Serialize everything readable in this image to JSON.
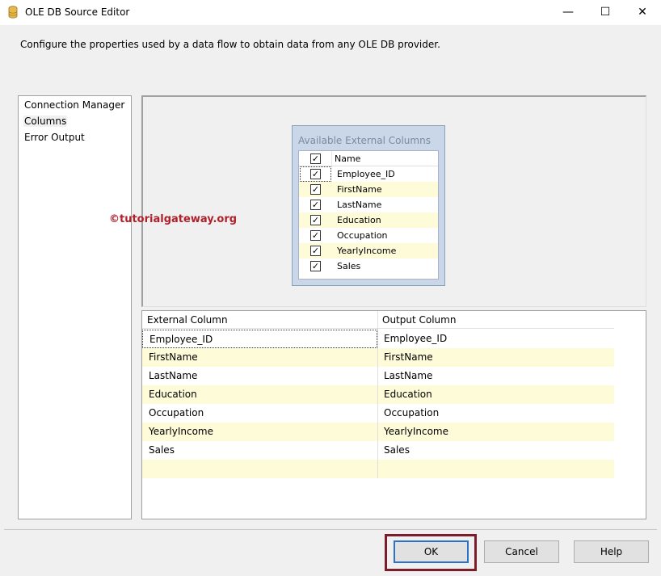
{
  "window": {
    "title": "OLE DB Source Editor",
    "minimize_glyph": "—",
    "maximize_glyph": "☐",
    "close_glyph": "✕",
    "icon": "database-icon"
  },
  "description": "Configure the properties used by a data flow to obtain data from any OLE DB provider.",
  "nav": {
    "items": [
      {
        "label": "Connection Manager",
        "selected": false
      },
      {
        "label": "Columns",
        "selected": true
      },
      {
        "label": "Error Output",
        "selected": false
      }
    ]
  },
  "available_columns": {
    "title": "Available External Columns",
    "header": "Name",
    "check_glyph": "✓",
    "columns": [
      {
        "name": "Employee_ID",
        "checked": true
      },
      {
        "name": "FirstName",
        "checked": true
      },
      {
        "name": "LastName",
        "checked": true
      },
      {
        "name": "Education",
        "checked": true
      },
      {
        "name": "Occupation",
        "checked": true
      },
      {
        "name": "YearlyIncome",
        "checked": true
      },
      {
        "name": "Sales",
        "checked": true
      }
    ]
  },
  "watermark": "©tutorialgateway.org",
  "mapping_grid": {
    "headers": [
      "External Column",
      "Output Column"
    ],
    "rows": [
      [
        "Employee_ID",
        "Employee_ID"
      ],
      [
        "FirstName",
        "FirstName"
      ],
      [
        "LastName",
        "LastName"
      ],
      [
        "Education",
        "Education"
      ],
      [
        "Occupation",
        "Occupation"
      ],
      [
        "YearlyIncome",
        "YearlyIncome"
      ],
      [
        "Sales",
        "Sales"
      ],
      [
        "",
        ""
      ]
    ]
  },
  "buttons": {
    "ok": "OK",
    "cancel": "Cancel",
    "help": "Help"
  },
  "colors": {
    "alt_row": "#fdfbd8",
    "watermark": "#b0202a",
    "ok_highlight": "#7b1d2a",
    "default_button_border": "#2b72c8"
  }
}
